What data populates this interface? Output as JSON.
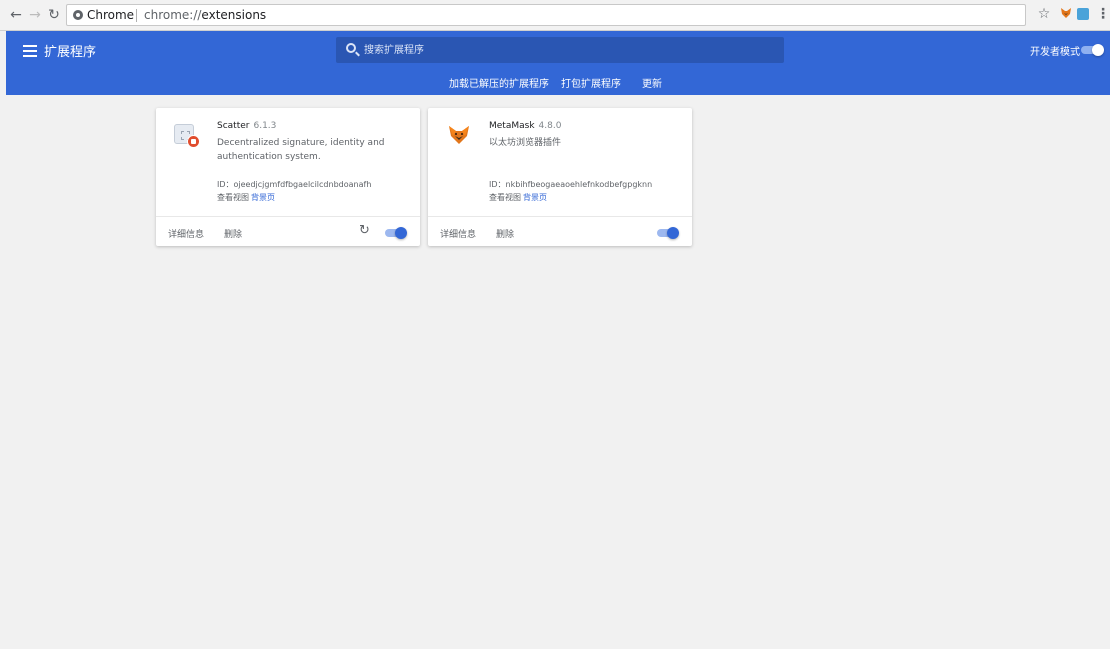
{
  "browser": {
    "site_label": "Chrome",
    "url_scheme": "chrome://",
    "url_host": "extensions"
  },
  "header": {
    "title": "扩展程序",
    "search_placeholder": "搜索扩展程序",
    "dev_mode_label": "开发者模式",
    "dev_mode_on": true,
    "actions": [
      "加载已解压的扩展程序",
      "打包扩展程序",
      "更新"
    ]
  },
  "extensions": [
    {
      "name": "Scatter",
      "version": "6.1.3",
      "description": "Decentralized signature, identity and authentication system.",
      "id_line": "ID：ojeedjcjgmfdfbgaelcilcdnbdoanafh",
      "views_label": "查看视图",
      "views_link": "背景页",
      "details_label": "详细信息",
      "remove_label": "删除",
      "enabled": true
    },
    {
      "name": "MetaMask",
      "version": "4.8.0",
      "description": "以太坊浏览器插件",
      "id_line": "ID：nkbihfbeogaeaoehlefnkodbefgpgknn",
      "views_label": "查看视图",
      "views_link": "背景页",
      "details_label": "详细信息",
      "remove_label": "删除",
      "enabled": true
    }
  ],
  "colors": {
    "header_bg": "#3367d6",
    "accent": "#3367d6",
    "page_bg": "#f1f1f1"
  }
}
